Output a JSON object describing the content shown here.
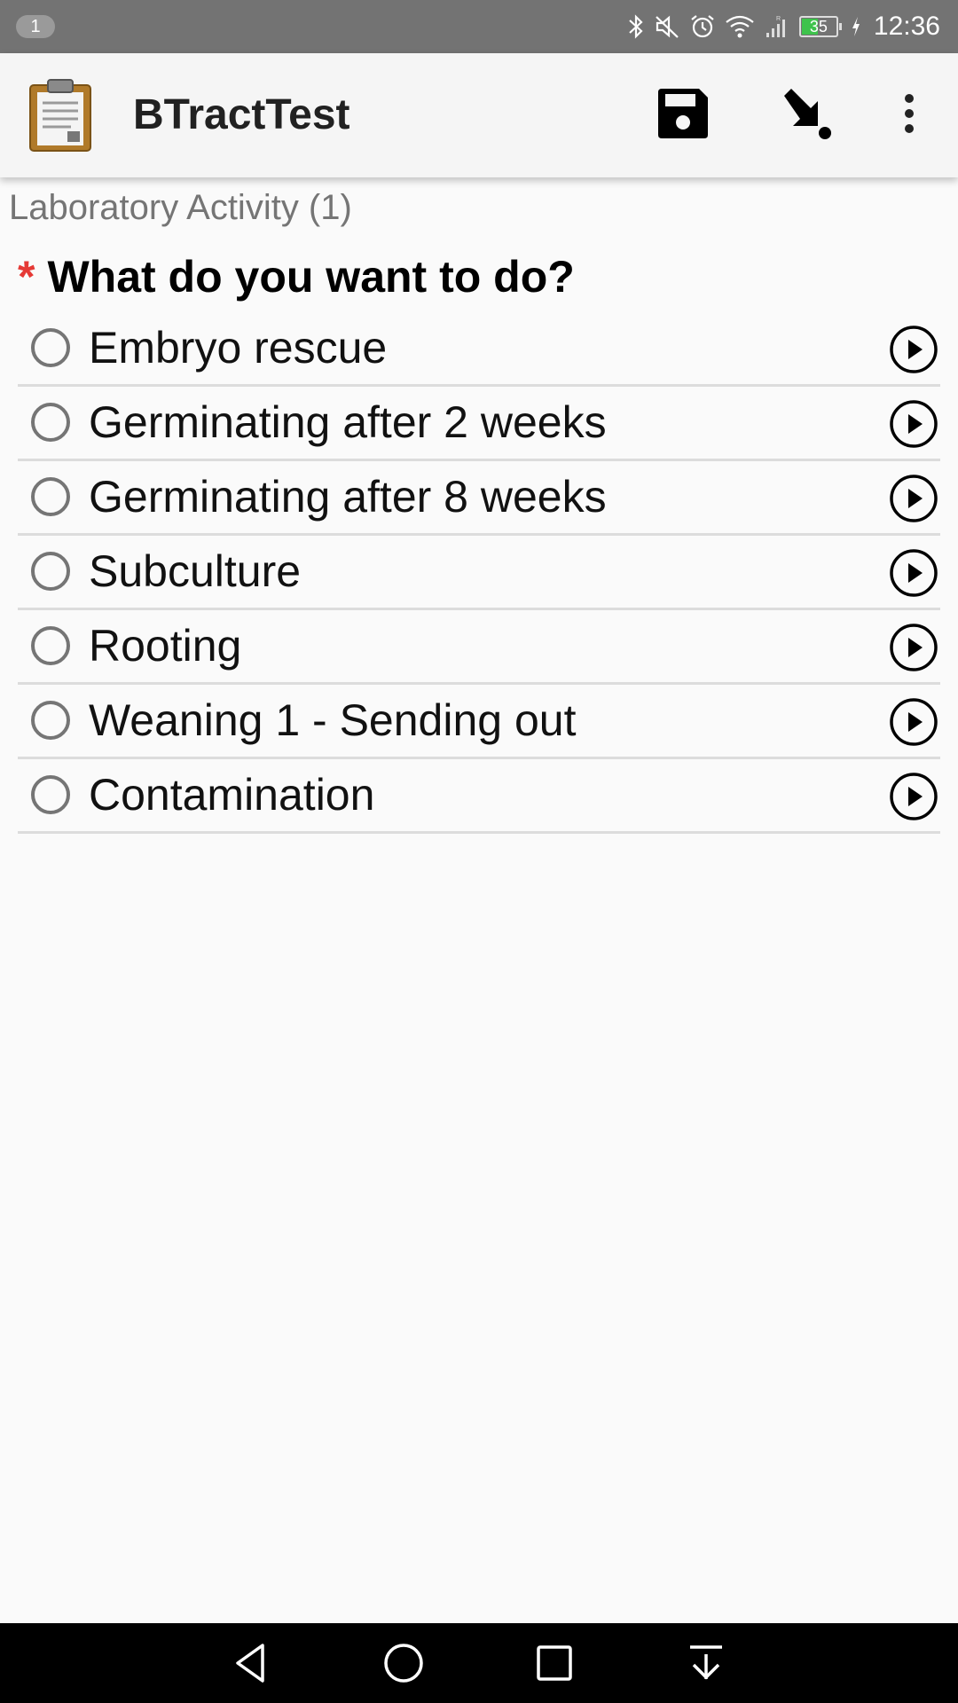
{
  "status_bar": {
    "notification_count": "1",
    "battery_level": "35",
    "time": "12:36",
    "icons": [
      "bluetooth-icon",
      "mute-icon",
      "alarm-icon",
      "wifi-icon",
      "signal-icon",
      "battery-icon",
      "charging-icon"
    ]
  },
  "app_bar": {
    "title": "BTractTest",
    "icons": [
      "clipboard-icon",
      "save-icon",
      "jump-icon",
      "more-vert-icon"
    ]
  },
  "form": {
    "breadcrumb": "Laboratory Activity (1)",
    "required_marker": "*",
    "question": "What do you want to do?",
    "options": [
      {
        "label": "Embryo rescue",
        "selected": false
      },
      {
        "label": "Germinating after 2 weeks",
        "selected": false
      },
      {
        "label": "Germinating after 8 weeks",
        "selected": false
      },
      {
        "label": "Subculture",
        "selected": false
      },
      {
        "label": "Rooting",
        "selected": false
      },
      {
        "label": "Weaning 1 - Sending out",
        "selected": false
      },
      {
        "label": "Contamination",
        "selected": false
      }
    ]
  },
  "nav_bar": {
    "icons": [
      "back-icon",
      "home-icon",
      "recents-icon",
      "notifications-pull-icon"
    ]
  },
  "colors": {
    "status_bar_bg": "#737373",
    "app_bar_bg": "#f5f5f5",
    "required_asterisk": "#e53935",
    "battery_fill": "#3ec34c"
  }
}
